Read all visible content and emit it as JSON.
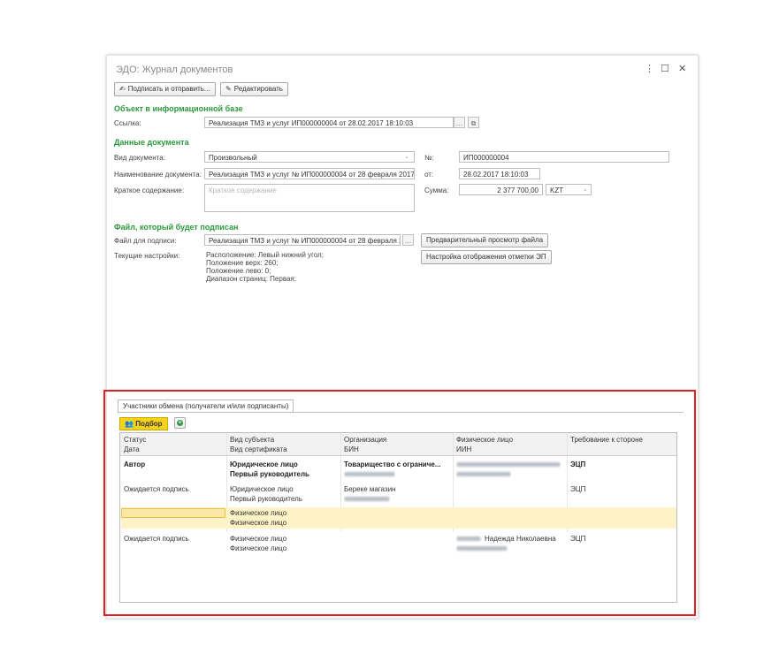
{
  "window": {
    "title": "ЭДО: Журнал документов",
    "menu_icon": "⋮",
    "maximize_icon": "☐",
    "close_icon": "✕"
  },
  "toolbar": {
    "sign_send_label": "Подписать и отправить...",
    "edit_label": "Редактировать"
  },
  "section_object": {
    "heading": "Объект в информационной базе",
    "link_label": "Ссылка:",
    "link_value": "Реализация ТМЗ и услуг ИП000000004 от 28.02.2017 18:10:03"
  },
  "section_doc": {
    "heading": "Данные документа",
    "doc_type_label": "Вид документа:",
    "doc_type_value": "Произвольный",
    "doc_name_label": "Наименование документа:",
    "doc_name_value": "Реализация ТМЗ и услуг № ИП000000004 от 28 февраля 2017 г.",
    "summary_label": "Краткое содержание:",
    "summary_placeholder": "Краткое содержание",
    "number_label": "№:",
    "number_value": "ИП000000004",
    "date_label": "от:",
    "date_value": "28.02.2017 18:10:03",
    "sum_label": "Сумма:",
    "sum_value": "2 377 700,00",
    "currency_value": "KZT"
  },
  "section_file": {
    "heading": "Файл, который будет подписан",
    "file_label": "Файл для подписи:",
    "file_value": "Реализация ТМЗ и услуг № ИП000000004 от 28 февраля 2017 г.",
    "settings_label": "Текущие настройки:",
    "settings_lines": [
      "Расположение: Левый нижний угол;",
      "Положение верх: 260;",
      "Положение лево: 0;",
      "Диапазон страниц: Первая;"
    ],
    "preview_button": "Предварительный просмотр файла",
    "stamp_button": "Настройка отображения отметки ЭП"
  },
  "participants": {
    "tab_label": "Участники обмена (получатели и/или подписанты)",
    "pick_label": "Подбор",
    "columns_row1": [
      "Статус",
      "Вид субъекта",
      "Организация",
      "Физическое лицо",
      "Требование к стороне"
    ],
    "columns_row2": [
      "Дата",
      "Вид сертификата",
      "БИН",
      "ИИН",
      ""
    ],
    "rows": [
      {
        "status": "Автор",
        "subject": "Юридическое лицо",
        "org": "Товарищество с ограниче...",
        "requirement": "ЭЦП",
        "date": "",
        "cert": "Первый руководитель",
        "bold": true
      },
      {
        "status": "Ожидается подпись",
        "subject": "Юридическое лицо",
        "org": "Береке магазин",
        "requirement": "ЭЦП",
        "date": "",
        "cert": "Первый руководитель",
        "bold": false
      },
      {
        "status": "",
        "subject": "Физическое лицо",
        "org": "",
        "requirement": "",
        "date": "",
        "cert": "Физическое лицо",
        "bold": false
      },
      {
        "status": "Ожидается подпись",
        "subject": "Физическое лицо",
        "org": "",
        "person": "Надежда Николаевна",
        "requirement": "ЭЦП",
        "date": "",
        "cert": "Физическое лицо",
        "bold": false
      }
    ]
  },
  "colors": {
    "section_heading": "#2c9a3c",
    "highlight_frame": "#e02020",
    "pick_button": "#f5d31a",
    "selected_row": "#fdf3c6"
  }
}
